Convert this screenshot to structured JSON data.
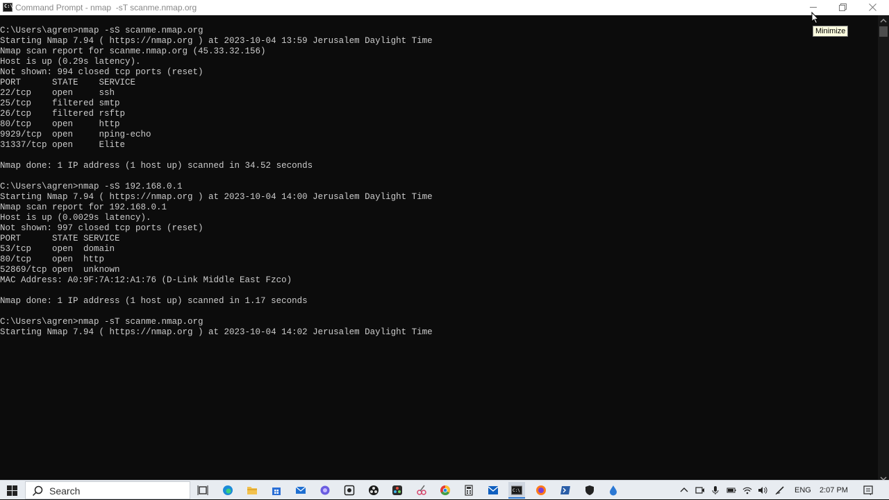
{
  "window": {
    "title": "Command Prompt - nmap  -sT scanme.nmap.org",
    "app_icon_label": "C:\\",
    "tooltip": "Minimize"
  },
  "console": {
    "lines": [
      "C:\\Users\\agren>nmap -sS scanme.nmap.org",
      "Starting Nmap 7.94 ( https://nmap.org ) at 2023-10-04 13:59 Jerusalem Daylight Time",
      "Nmap scan report for scanme.nmap.org (45.33.32.156)",
      "Host is up (0.29s latency).",
      "Not shown: 994 closed tcp ports (reset)",
      "PORT      STATE    SERVICE",
      "22/tcp    open     ssh",
      "25/tcp    filtered smtp",
      "26/tcp    filtered rsftp",
      "80/tcp    open     http",
      "9929/tcp  open     nping-echo",
      "31337/tcp open     Elite",
      "",
      "Nmap done: 1 IP address (1 host up) scanned in 34.52 seconds",
      "",
      "C:\\Users\\agren>nmap -sS 192.168.0.1",
      "Starting Nmap 7.94 ( https://nmap.org ) at 2023-10-04 14:00 Jerusalem Daylight Time",
      "Nmap scan report for 192.168.0.1",
      "Host is up (0.0029s latency).",
      "Not shown: 997 closed tcp ports (reset)",
      "PORT      STATE SERVICE",
      "53/tcp    open  domain",
      "80/tcp    open  http",
      "52869/tcp open  unknown",
      "MAC Address: A0:9F:7A:12:A1:76 (D-Link Middle East Fzco)",
      "",
      "Nmap done: 1 IP address (1 host up) scanned in 1.17 seconds",
      "",
      "C:\\Users\\agren>nmap -sT scanme.nmap.org",
      "Starting Nmap 7.94 ( https://nmap.org ) at 2023-10-04 14:02 Jerusalem Daylight Time"
    ]
  },
  "taskbar": {
    "search_label": "Search",
    "language": "ENG",
    "clock": "2:07 PM"
  },
  "colors": {
    "console_bg": "#0c0c0c",
    "console_text": "#cccccc",
    "taskbar_bg": "#e8ecf1"
  }
}
